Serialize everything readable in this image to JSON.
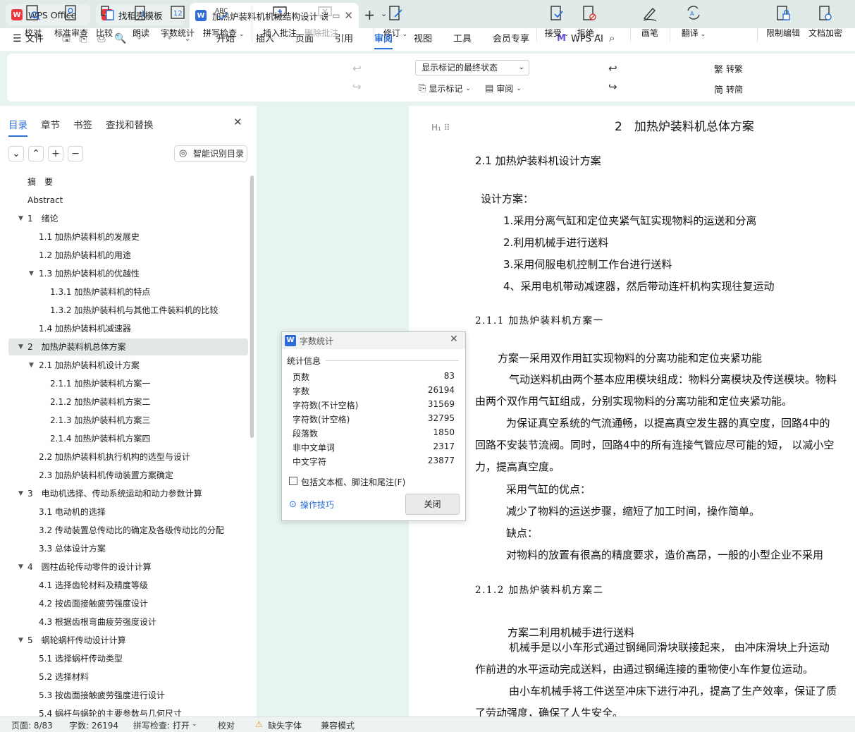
{
  "tabs": [
    {
      "title": "WPS Office",
      "logo": "W"
    },
    {
      "title": "找稻壳模板",
      "logo": "稻"
    },
    {
      "title": "加热炉装料机机械结构设计 说",
      "logo": "W"
    }
  ],
  "menu": {
    "file": "文件",
    "items": [
      "开始",
      "插入",
      "页面",
      "引用",
      "审阅",
      "视图",
      "工具",
      "会员专享"
    ],
    "ai": "WPS AI"
  },
  "ribbon": {
    "proofread": "校对",
    "standard_review": "标准审查",
    "compare": "比较",
    "read_aloud": "朗读",
    "word_count": "字数统计",
    "spell_check": "拼写检查",
    "insert_comment": "插入批注",
    "delete_comment": "删除批注",
    "revise": "修订",
    "markup_state": "显示标记的最终状态",
    "show_markup": "显示标记",
    "review": "审阅",
    "accept": "接受",
    "reject": "拒绝",
    "pen": "画笔",
    "translate": "翻译",
    "to_traditional": "转繁",
    "to_simplified": "转简",
    "restrict_editing": "限制编辑",
    "encrypt": "文档加密"
  },
  "nav": {
    "tabs": [
      "目录",
      "章节",
      "书签",
      "查找和替换"
    ],
    "smart_toc": "智能识别目录",
    "items": [
      {
        "text": "摘　要",
        "level": 0,
        "arrow": ""
      },
      {
        "text": "Abstract",
        "level": 0,
        "arrow": ""
      },
      {
        "text": "1　绪论",
        "level": 0,
        "arrow": "▼"
      },
      {
        "text": "1.1  加热炉装料机的发展史",
        "level": 1,
        "arrow": ""
      },
      {
        "text": "1.2  加热炉装料机的用途",
        "level": 1,
        "arrow": ""
      },
      {
        "text": "1.3  加热炉装料机的优越性",
        "level": 1,
        "arrow": "▼"
      },
      {
        "text": "1.3.1  加热炉装料机的特点",
        "level": 2,
        "arrow": ""
      },
      {
        "text": "1.3.2  加热炉装料机与其他工件装料机的比较",
        "level": 2,
        "arrow": ""
      },
      {
        "text": "1.4 加热炉装料机减速器",
        "level": 1,
        "arrow": ""
      },
      {
        "text": "2　加热炉装料机总体方案",
        "level": 0,
        "arrow": "▼",
        "selected": true
      },
      {
        "text": "2.1  加热炉装料机设计方案",
        "level": 1,
        "arrow": "▼"
      },
      {
        "text": "2.1.1 加热炉装料机方案一",
        "level": 2,
        "arrow": ""
      },
      {
        "text": "2.1.2  加热炉装料机方案二",
        "level": 2,
        "arrow": ""
      },
      {
        "text": "2.1.3 加热炉装料机方案三",
        "level": 2,
        "arrow": ""
      },
      {
        "text": "2.1.4 加热炉装料机方案四",
        "level": 2,
        "arrow": ""
      },
      {
        "text": "2.2  加热炉装料机执行机构的选型与设计",
        "level": 1,
        "arrow": ""
      },
      {
        "text": "2.3  加热炉装料机传动装置方案确定",
        "level": 1,
        "arrow": ""
      },
      {
        "text": "3　电动机选择、传动系统运动和动力参数计算",
        "level": 0,
        "arrow": "▼"
      },
      {
        "text": "3.1 电动机的选择",
        "level": 1,
        "arrow": ""
      },
      {
        "text": "3.2  传动装置总传动比的确定及各级传动比的分配",
        "level": 1,
        "arrow": ""
      },
      {
        "text": "3.3  总体设计方案",
        "level": 1,
        "arrow": ""
      },
      {
        "text": "4　圆柱齿轮传动零件的设计计算",
        "level": 0,
        "arrow": "▼"
      },
      {
        "text": "4.1  选择齿轮材料及精度等级",
        "level": 1,
        "arrow": ""
      },
      {
        "text": "4.2 按齿面接触疲劳强度设计",
        "level": 1,
        "arrow": ""
      },
      {
        "text": "4.3  根据齿根弯曲疲劳强度设计",
        "level": 1,
        "arrow": ""
      },
      {
        "text": "5　蜗轮蜗杆传动设计计算",
        "level": 0,
        "arrow": "▼"
      },
      {
        "text": "5.1  选择蜗杆传动类型",
        "level": 1,
        "arrow": ""
      },
      {
        "text": "5.2  选择材料",
        "level": 1,
        "arrow": ""
      },
      {
        "text": "5.3  按齿面接触疲劳强度进行设计",
        "level": 1,
        "arrow": ""
      },
      {
        "text": "5.4  蜗杆与蜗轮的主要参数与几何尺寸",
        "level": 1,
        "arrow": ""
      }
    ]
  },
  "document": {
    "lines": [
      {
        "text": "2　加热炉装料机总体方案",
        "style": "head"
      },
      {
        "text": "2.1  加热炉装料机设计方案",
        "style": "normal"
      },
      {
        "text": "设计方案：",
        "style": "normal"
      },
      {
        "text": "1.采用分离气缸和定位夹紧气缸实现物料的运送和分离",
        "style": "normal"
      },
      {
        "text": "2.利用机械手进行送料",
        "style": "normal"
      },
      {
        "text": "3.采用伺服电机控制工作台进行送料",
        "style": "normal"
      },
      {
        "text": "4、采用电机带动减速器，然后带动连杆机构实现往复运动",
        "style": "normal"
      },
      {
        "text": "2.1.1 加热炉装料机方案一",
        "style": "serif"
      },
      {
        "text": "方案一采用双作用缸实现物料的分离功能和定位夹紧功能",
        "style": "normal"
      },
      {
        "text": "气动送料机由两个基本应用模块组成：物料分离模块及传送模块。物料",
        "style": "normal"
      },
      {
        "text": "由两个双作用气缸组成，分别实现物料的分离功能和定位夹紧功能。",
        "style": "normal"
      },
      {
        "text": "为保证真空系统的气流通畅，以提高真空发生器的真空度，回路4中的",
        "style": "normal"
      },
      {
        "text": "回路不安装节流阀。同时，回路4中的所有连接气管应尽可能的短，  以减小空",
        "style": "normal"
      },
      {
        "text": "力，提高真空度。",
        "style": "normal"
      },
      {
        "text": "采用气缸的优点：",
        "style": "normal"
      },
      {
        "text": "减少了物料的运送步骤，缩短了加工时间，操作简单。",
        "style": "normal"
      },
      {
        "text": "缺点：",
        "style": "normal"
      },
      {
        "text": "对物料的放置有很高的精度要求，造价高昂，一般的小型企业不采用",
        "style": "normal"
      },
      {
        "text": "2.1.2  加热炉装料机方案二",
        "style": "serif"
      },
      {
        "text": "方案二利用机械手进行送料",
        "style": "normal"
      },
      {
        "text": "机械手是以小车形式通过钢绳同滑块联接起来，  由冲床滑块上升运动",
        "style": "normal"
      },
      {
        "text": "作前进的水平运动完成送料，由通过钢绳连接的重物使小车作复位运动。",
        "style": "normal"
      },
      {
        "text": "由小车机械手将工件送至冲床下进行冲孔，提高了生产效率，保证了质",
        "style": "normal"
      },
      {
        "text": "了劳动强度，确保了人生安全。",
        "style": "normal"
      }
    ]
  },
  "dialog": {
    "title": "字数统计",
    "section": "统计信息",
    "stats": [
      {
        "label": "页数",
        "value": "83"
      },
      {
        "label": "字数",
        "value": "26194"
      },
      {
        "label": "字符数(不计空格)",
        "value": "31569"
      },
      {
        "label": "字符数(计空格)",
        "value": "32795"
      },
      {
        "label": "段落数",
        "value": "1850"
      },
      {
        "label": "非中文单词",
        "value": "2317"
      },
      {
        "label": "中文字符",
        "value": "23877"
      }
    ],
    "include_label": "包括文本框、脚注和尾注(F)",
    "tips": "操作技巧",
    "close": "关闭"
  },
  "status": {
    "page": "页面: 8/83",
    "words": "字数: 26194",
    "spell": "拼写检查: 打开",
    "proof": "校对",
    "missing_font": "缺失字体",
    "compat": "兼容模式"
  },
  "colors": {
    "accent": "#2b6fd8",
    "wps_red": "#e8383d",
    "word_blue": "#2f6bd6"
  }
}
